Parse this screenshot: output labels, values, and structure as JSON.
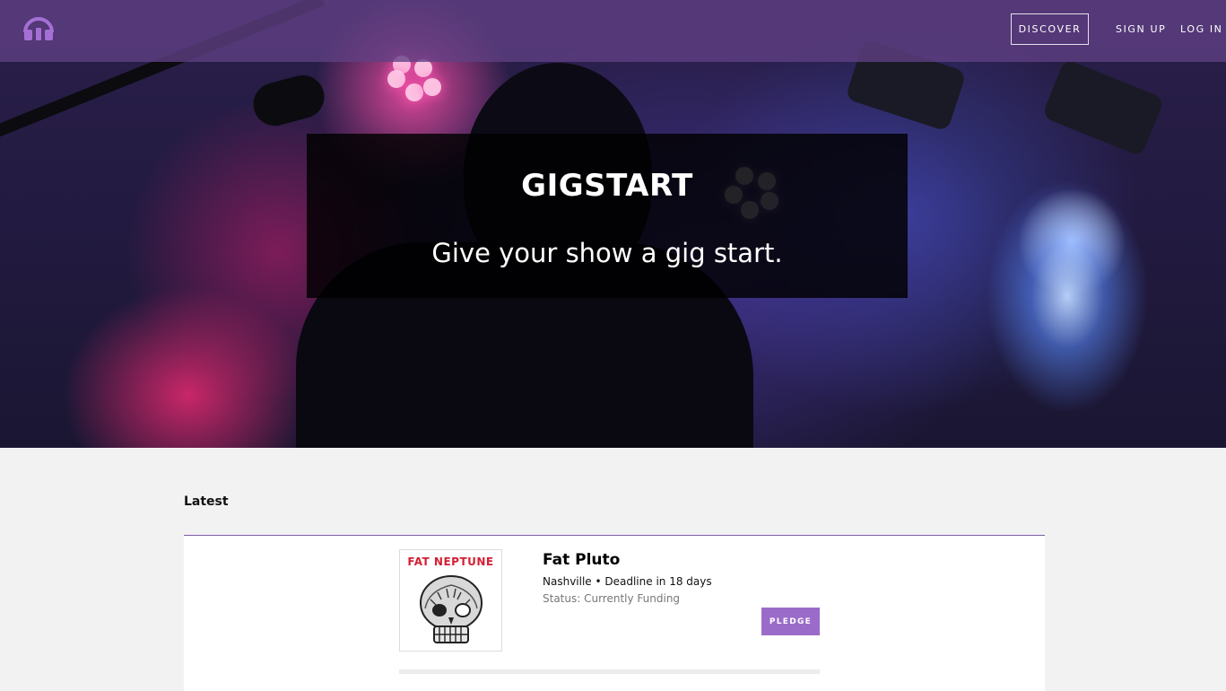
{
  "nav": {
    "logo_icon": "headphones-icon",
    "discover_label": "DISCOVER",
    "signup_label": "SIGN UP",
    "login_label": "LOG IN"
  },
  "hero": {
    "title": "GIGSTART",
    "subtitle": "Give your show a gig start."
  },
  "latest": {
    "heading": "Latest",
    "projects": [
      {
        "cover_text": "FAT NEPTUNE",
        "cover_icon": "skull-illustration",
        "title": "Fat Pluto",
        "meta": "Nashville • Deadline in 18 days",
        "status": "Status: Currently Funding",
        "pledge_label": "PLEDGE"
      }
    ]
  },
  "colors": {
    "nav_bg": "#604084",
    "accent": "#9b6bc9",
    "divider": "#7b5aa6",
    "cover_text": "#d51f33"
  }
}
